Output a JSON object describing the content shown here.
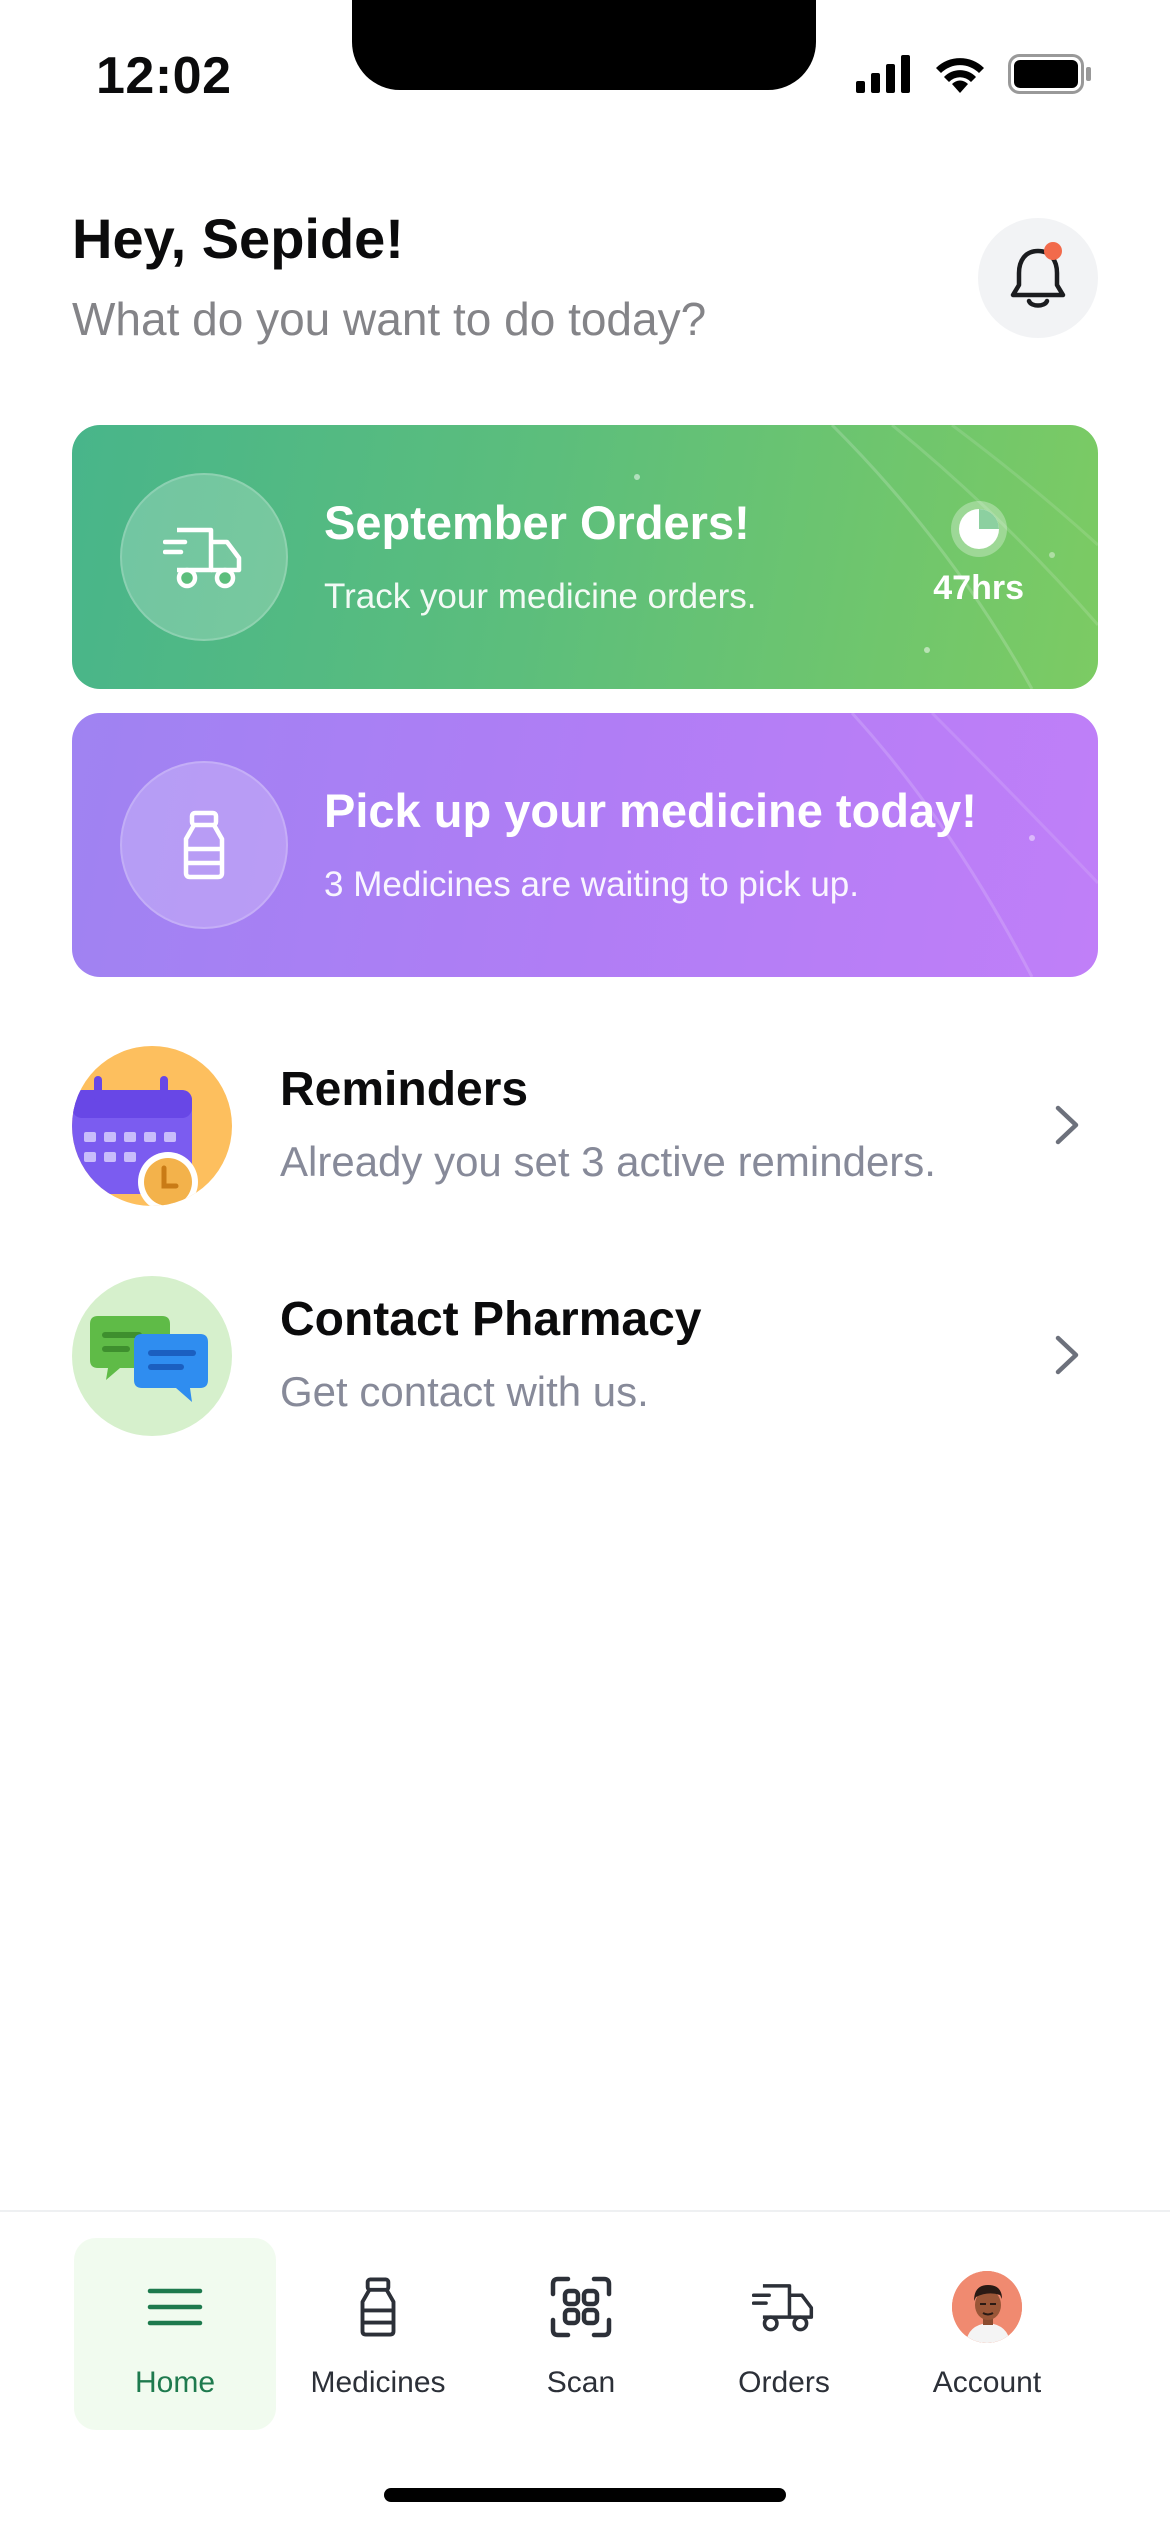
{
  "status_bar": {
    "time": "12:02"
  },
  "header": {
    "greeting": "Hey, Sepide!",
    "subtitle": "What do you want to do today?",
    "notification_icon": "bell-icon",
    "notification_badge_color": "#f26a4b"
  },
  "cards": [
    {
      "title": "September Orders!",
      "subtitle": "Track your medicine orders.",
      "icon": "truck-icon",
      "timer": "47hrs",
      "gradient": [
        "#48b58a",
        "#7ccb63"
      ]
    },
    {
      "title": "Pick up your medicine today!",
      "subtitle": "3 Medicines are waiting to pick up.",
      "icon": "bottle-icon",
      "gradient": [
        "#9f83f2",
        "#c07ff8"
      ]
    }
  ],
  "list": [
    {
      "title": "Reminders",
      "subtitle": "Already you set 3 active reminders.",
      "icon": "calendar-icon"
    },
    {
      "title": "Contact Pharmacy",
      "subtitle": "Get contact with us.",
      "icon": "chat-bubbles-icon"
    }
  ],
  "nav": [
    {
      "label": "Home",
      "icon": "menu-icon",
      "active": true
    },
    {
      "label": "Medicines",
      "icon": "bottle-icon"
    },
    {
      "label": "Scan",
      "icon": "scan-icon"
    },
    {
      "label": "Orders",
      "icon": "truck-icon"
    },
    {
      "label": "Account",
      "icon": "avatar"
    }
  ],
  "colors": {
    "active_nav": "#1e7a4e",
    "active_nav_bg": "#f1fbef"
  }
}
